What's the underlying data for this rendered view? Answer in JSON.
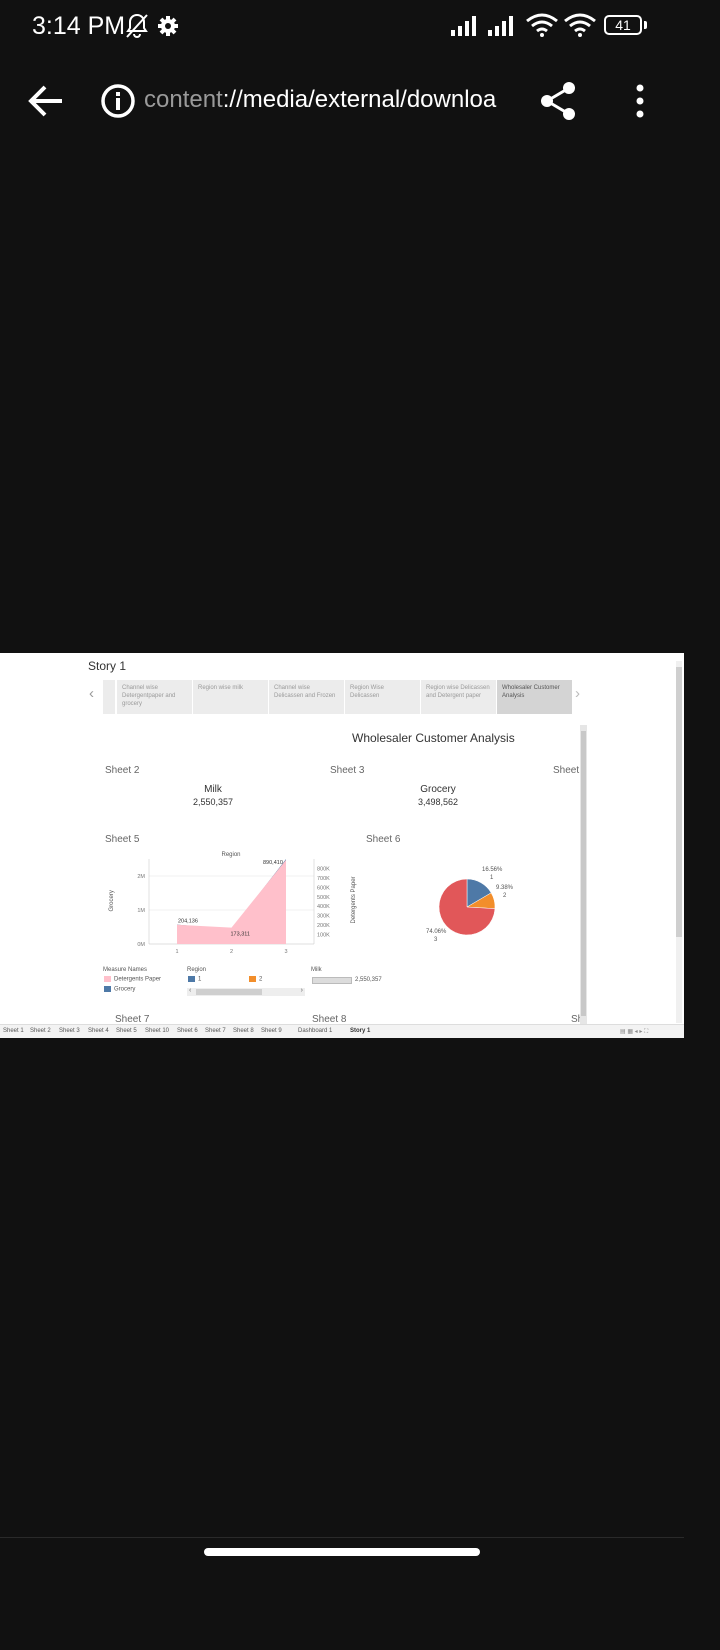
{
  "status": {
    "time": "3:14 PM",
    "battery": "41"
  },
  "browser": {
    "url_scheme": "content",
    "url_rest": "://media/external/downloa"
  },
  "story": {
    "title": "Story 1",
    "tabs": [
      {
        "label": "Channel wise Detergentpaper and grocery"
      },
      {
        "label": "Region wise milk"
      },
      {
        "label": "Channel wise Delicassen and Frozen"
      },
      {
        "label": "Region Wise Delicassen"
      },
      {
        "label": "Region wise Delicassen and Detergent paper"
      },
      {
        "label": "Wholesaler Customer Analysis"
      }
    ],
    "active_tab": 5
  },
  "dashboard": {
    "title": "Wholesaler Customer Analysis",
    "sheet2": "Sheet 2",
    "sheet3": "Sheet 3",
    "sheet4": "Sheet",
    "sheet5": "Sheet 5",
    "sheet6": "Sheet 6",
    "sheet7": "Sheet 7",
    "sheet8": "Sheet 8",
    "sheet9": "Sh",
    "kpis": [
      {
        "name": "Milk",
        "value": "2,550,357"
      },
      {
        "name": "Grocery",
        "value": "3,498,562"
      }
    ],
    "legend": {
      "measure_title": "Measure Names",
      "measures": [
        {
          "label": "Detergents Paper",
          "color": "#ffc0cb"
        },
        {
          "label": "Grocery",
          "color": "#4e79a7"
        }
      ],
      "region_title": "Region",
      "regions": [
        {
          "label": "1",
          "color": "#4e79a7"
        },
        {
          "label": "2",
          "color": "#f28e2b"
        }
      ],
      "milk_title": "Milk",
      "milk_value": "2,550,357"
    }
  },
  "chart_data": [
    {
      "type": "area",
      "title": "Region",
      "xlabel": "",
      "ylabel": "Grocery",
      "y2label": "Detergents Paper",
      "categories": [
        "1",
        "2",
        "3"
      ],
      "yticks": [
        "0M",
        "1M",
        "2M"
      ],
      "y2ticks": [
        "100K",
        "200K",
        "300K",
        "400K",
        "500K",
        "600K",
        "700K",
        "800K"
      ],
      "series": [
        {
          "name": "Grocery",
          "values": [
            570037,
            433274,
            2495251
          ],
          "color": "#4e79a7"
        },
        {
          "name": "Detergents Paper",
          "values": [
            204136,
            173311,
            890410
          ],
          "color": "#ffc0cb"
        }
      ],
      "ylim": [
        0,
        2500000
      ],
      "y2lim": [
        0,
        900000
      ],
      "data_labels": [
        "204,136",
        "173,311",
        "890,410"
      ]
    },
    {
      "type": "pie",
      "slices": [
        {
          "label": "3",
          "value": 74.06,
          "text": "74.06%",
          "color": "#e15759"
        },
        {
          "label": "1",
          "value": 16.56,
          "text": "16.56%",
          "color": "#4e79a7"
        },
        {
          "label": "2",
          "value": 9.38,
          "text": "9.38%",
          "color": "#f28e2b"
        }
      ]
    }
  ],
  "bottom_tabs": [
    "Sheet 1",
    "Sheet 2",
    "Sheet 3",
    "Sheet 4",
    "Sheet 5",
    "Sheet 10",
    "Sheet 6",
    "Sheet 7",
    "Sheet 8",
    "Sheet 9",
    "Dashboard 1",
    "Story 1"
  ]
}
